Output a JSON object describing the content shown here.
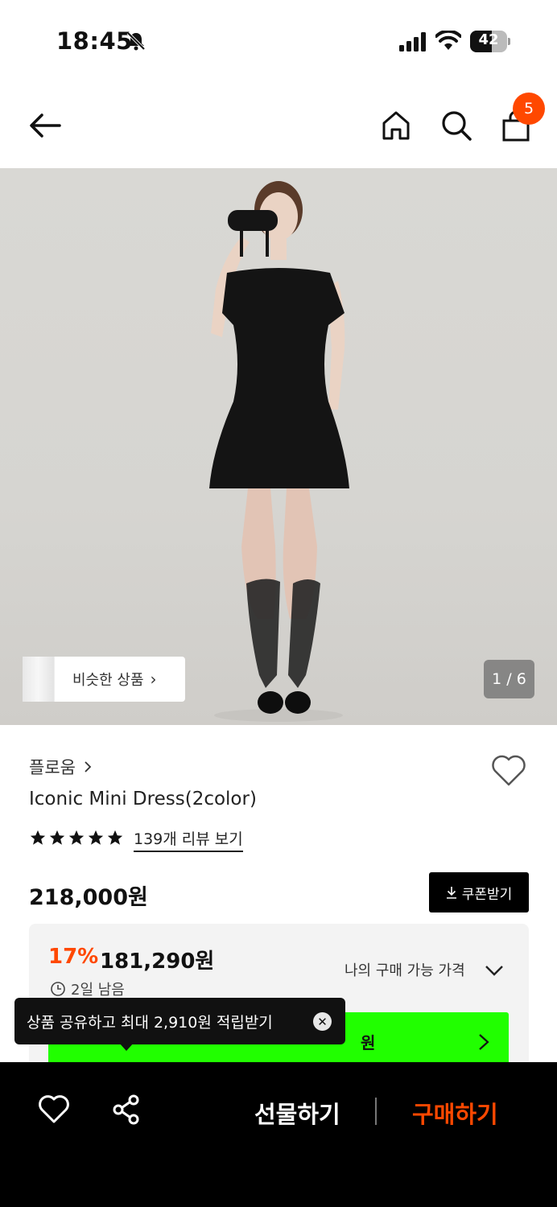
{
  "status_bar": {
    "time": "18:45",
    "battery": "42"
  },
  "header": {
    "cart_count": "5"
  },
  "hero": {
    "similar_label": "비슷한 상품",
    "pager": "1 / 6"
  },
  "product": {
    "brand": "플로움",
    "title": "Iconic Mini Dress(2color)",
    "rating_stars": 5,
    "review_link": "139개 리뷰 보기",
    "price": "218,000원",
    "coupon_label": "쿠폰받기"
  },
  "discount": {
    "rate": "17%",
    "price": "181,290원",
    "my_price_label": "나의 구매 가능 가격",
    "time_left": "2일 남음",
    "banner_text": "원"
  },
  "tooltip": {
    "text": "상품 공유하고 최대 2,910원 적립받기"
  },
  "bottom_bar": {
    "gift_label": "선물하기",
    "buy_label": "구매하기"
  },
  "colors": {
    "accent": "#ff4800",
    "green_banner": "#21ff00"
  }
}
